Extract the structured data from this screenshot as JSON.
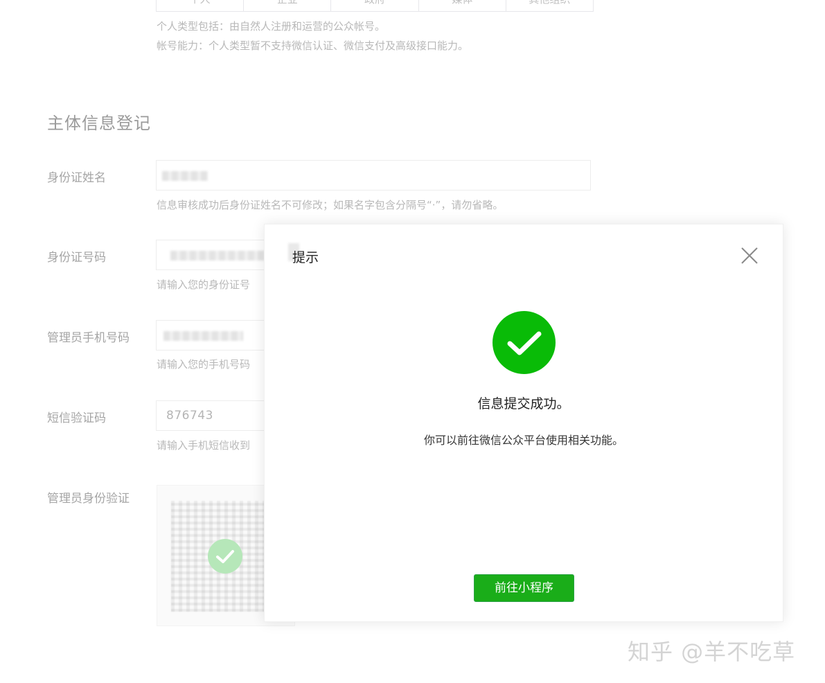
{
  "account_types": [
    "个人",
    "企业",
    "政府",
    "媒体",
    "其他组织"
  ],
  "type_tips": [
    "个人类型包括：由自然人注册和运营的公众帐号。",
    "帐号能力：个人类型暂不支持微信认证、微信支付及高级接口能力。"
  ],
  "section_title": "主体信息登记",
  "fields": {
    "id_name": {
      "label": "身份证姓名",
      "tip": "信息审核成功后身份证姓名不可修改；如果名字包含分隔号“·”，请勿省略。"
    },
    "id_number": {
      "label": "身份证号码",
      "tip": "请输入您的身份证号"
    },
    "phone": {
      "label": "管理员手机号码",
      "tip": "请输入您的手机号码"
    },
    "sms_code": {
      "label": "短信验证码",
      "value": "876743",
      "tip": "请输入手机短信收到"
    },
    "admin_verify": {
      "label": "管理员身份验证"
    }
  },
  "dialog": {
    "title": "提示",
    "message": "信息提交成功。",
    "description": "你可以前往微信公众平台使用相关功能。",
    "button_label": "前往小程序"
  },
  "colors": {
    "primary_green": "#1aad19",
    "success_green": "#09bb07"
  },
  "watermark": "知乎 @羊不吃草"
}
